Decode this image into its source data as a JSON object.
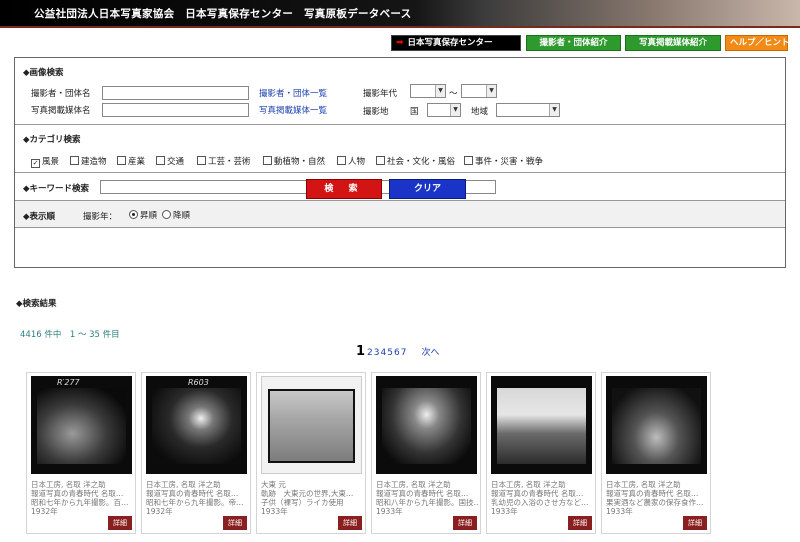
{
  "header": {
    "title": "公益社団法人日本写真家協会　日本写真保存センター　写真原板データベース"
  },
  "nav": {
    "center_label": "日本写真保存センター",
    "photographer_label": "撮影者・団体紹介",
    "media_label": "写真掲載媒体紹介",
    "help_label": "ヘルプ／ヒント"
  },
  "image_search": {
    "title": "◆画像検索",
    "photographer_label": "撮影者・団体名",
    "photographer_value": "",
    "photographer_list_link": "撮影者・団体一覧",
    "media_label": "写真掲載媒体名",
    "media_value": "",
    "media_list_link": "写真掲載媒体一覧",
    "year_label": "撮影年代",
    "year_sep": "〜",
    "place_label": "撮影地",
    "country_label": "国",
    "region_label": "地域"
  },
  "category_search": {
    "title": "◆カテゴリ検索",
    "items": [
      {
        "label": "風景",
        "checked": true
      },
      {
        "label": "建造物",
        "checked": false
      },
      {
        "label": "産業",
        "checked": false
      },
      {
        "label": "交通",
        "checked": false
      },
      {
        "label": "工芸・芸術",
        "checked": false
      },
      {
        "label": "動植物・自然",
        "checked": false
      },
      {
        "label": "人物",
        "checked": false
      },
      {
        "label": "社会・文化・風俗",
        "checked": false
      },
      {
        "label": "事件・災害・戦争",
        "checked": false
      }
    ]
  },
  "keyword_search": {
    "title": "◆キーワード検索",
    "value": ""
  },
  "order": {
    "title": "◆表示順",
    "field_label": "撮影年：",
    "asc_label": "昇順",
    "desc_label": "降順",
    "selected": "asc"
  },
  "actions": {
    "search_label": "検 索",
    "clear_label": "クリア"
  },
  "results": {
    "title": "◆検索結果",
    "count_text": "4416 件中　1 〜 35 件目",
    "current_page": "1",
    "pages": [
      "2",
      "3",
      "4",
      "5",
      "6",
      "7"
    ],
    "next_label": "次へ",
    "detail_label": "詳細",
    "cards": [
      {
        "code": "R′277",
        "line1": "日本工房, 名取 洋之助",
        "line2": "報道写真の青春時代 名取…",
        "line3": "昭和七年から九年撮影。百…",
        "year": "1932年"
      },
      {
        "code": "R603",
        "line1": "日本工房, 名取 洋之助",
        "line2": "報道写真の青春時代 名取…",
        "line3": "昭和七年から九年撮影。帝…",
        "year": "1932年"
      },
      {
        "code": "",
        "line1": "大東 元",
        "line2": "軌跡　大東元の世界,大東…",
        "line3": "子供（裸写）ライカ使用",
        "year": "1933年"
      },
      {
        "code": "",
        "line1": "日本工房, 名取 洋之助",
        "line2": "報道写真の青春時代 名取…",
        "line3": "昭和八年から九年撮影。国技…",
        "year": "1933年"
      },
      {
        "code": "",
        "line1": "日本工房, 名取 洋之助",
        "line2": "報道写真の青春時代 名取…",
        "line3": "乳幼児の入浴のさせ方など…",
        "year": "1933年"
      },
      {
        "code": "",
        "line1": "日本工房, 名取 洋之助",
        "line2": "報道写真の青春時代 名取…",
        "line3": "果実酒など農家の保存食作…",
        "year": "1933年"
      }
    ]
  }
}
